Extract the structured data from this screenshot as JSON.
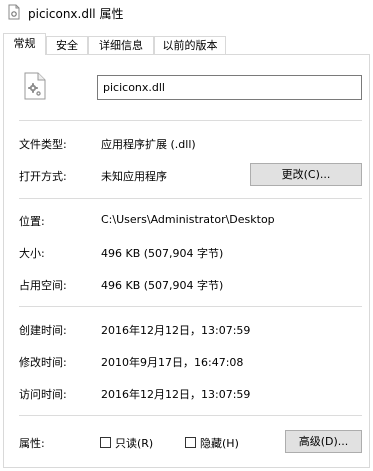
{
  "window": {
    "title": "piciconx.dll 属性"
  },
  "tabs": [
    {
      "label": "常规",
      "active": true
    },
    {
      "label": "安全",
      "active": false
    },
    {
      "label": "详细信息",
      "active": false
    },
    {
      "label": "以前的版本",
      "active": false
    }
  ],
  "general": {
    "file_name": "piciconx.dll",
    "file_icon": "dll-gear-icon",
    "file_type_label": "文件类型:",
    "file_type_value": "应用程序扩展 (.dll)",
    "opens_with_label": "打开方式:",
    "opens_with_value": "未知应用程序",
    "change_button": "更改(C)...",
    "location_label": "位置:",
    "location_value": "C:\\Users\\Administrator\\Desktop",
    "size_label": "大小:",
    "size_value": "496 KB (507,904 字节)",
    "size_on_disk_label": "占用空间:",
    "size_on_disk_value": "496 KB (507,904 字节)",
    "created_label": "创建时间:",
    "created_value": "2016年12月12日，13:07:59",
    "modified_label": "修改时间:",
    "modified_value": "2010年9月17日，16:47:08",
    "accessed_label": "访问时间:",
    "accessed_value": "2016年12月12日，13:07:59",
    "attributes_label": "属性:",
    "readonly_label": "只读(R)",
    "readonly_checked": false,
    "hidden_label": "隐藏(H)",
    "hidden_checked": false,
    "advanced_button": "高级(D)..."
  }
}
